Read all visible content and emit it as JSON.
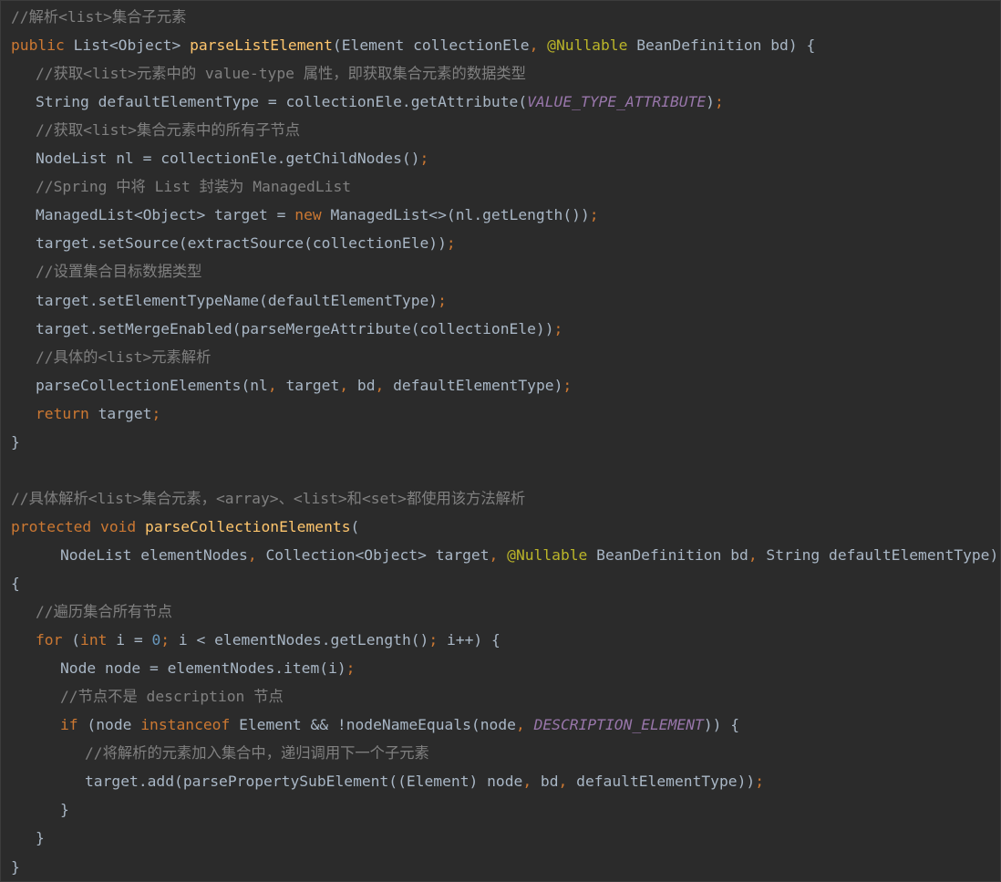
{
  "colors": {
    "background": "#2b2b2b",
    "plain": "#a9b7c6",
    "keyword": "#cc7832",
    "function": "#ffc66d",
    "comment": "#808080",
    "constant": "#9876aa",
    "annotation": "#bbb529",
    "number": "#6897bb"
  },
  "lines": [
    {
      "indent": 0,
      "tokens": [
        {
          "t": "//解析<list>集合子元素",
          "c": "cm"
        }
      ]
    },
    {
      "indent": 0,
      "tokens": [
        {
          "t": "public ",
          "c": "kw"
        },
        {
          "t": "List<Object> ",
          "c": "plain"
        },
        {
          "t": "parseListElement",
          "c": "fn"
        },
        {
          "t": "(Element collectionEle",
          "c": "plain"
        },
        {
          "t": ", ",
          "c": "kw"
        },
        {
          "t": "@Nullable ",
          "c": "ann"
        },
        {
          "t": "BeanDefinition bd) {",
          "c": "plain"
        }
      ]
    },
    {
      "indent": 1,
      "tokens": [
        {
          "t": "//获取<list>元素中的 value-type 属性，即获取集合元素的数据类型",
          "c": "cm"
        }
      ]
    },
    {
      "indent": 1,
      "tokens": [
        {
          "t": "String defaultElementType = collectionEle.getAttribute(",
          "c": "plain"
        },
        {
          "t": "VALUE_TYPE_ATTRIBUTE",
          "c": "const"
        },
        {
          "t": ")",
          "c": "plain"
        },
        {
          "t": ";",
          "c": "kw"
        }
      ]
    },
    {
      "indent": 1,
      "tokens": [
        {
          "t": "//获取<list>集合元素中的所有子节点",
          "c": "cm"
        }
      ]
    },
    {
      "indent": 1,
      "tokens": [
        {
          "t": "NodeList nl = collectionEle.getChildNodes()",
          "c": "plain"
        },
        {
          "t": ";",
          "c": "kw"
        }
      ]
    },
    {
      "indent": 1,
      "tokens": [
        {
          "t": "//Spring 中将 List 封装为 ManagedList",
          "c": "cm"
        }
      ]
    },
    {
      "indent": 1,
      "tokens": [
        {
          "t": "ManagedList<Object> target = ",
          "c": "plain"
        },
        {
          "t": "new ",
          "c": "kw"
        },
        {
          "t": "ManagedList<>(nl.getLength())",
          "c": "plain"
        },
        {
          "t": ";",
          "c": "kw"
        }
      ]
    },
    {
      "indent": 1,
      "tokens": [
        {
          "t": "target.setSource(extractSource(collectionEle))",
          "c": "plain"
        },
        {
          "t": ";",
          "c": "kw"
        }
      ]
    },
    {
      "indent": 1,
      "tokens": [
        {
          "t": "//设置集合目标数据类型",
          "c": "cm"
        }
      ]
    },
    {
      "indent": 1,
      "tokens": [
        {
          "t": "target.setElementTypeName(defaultElementType)",
          "c": "plain"
        },
        {
          "t": ";",
          "c": "kw"
        }
      ]
    },
    {
      "indent": 1,
      "tokens": [
        {
          "t": "target.setMergeEnabled(parseMergeAttribute(collectionEle))",
          "c": "plain"
        },
        {
          "t": ";",
          "c": "kw"
        }
      ]
    },
    {
      "indent": 1,
      "tokens": [
        {
          "t": "//具体的<list>元素解析",
          "c": "cm"
        }
      ]
    },
    {
      "indent": 1,
      "tokens": [
        {
          "t": "parseCollectionElements(nl",
          "c": "plain"
        },
        {
          "t": ", ",
          "c": "kw"
        },
        {
          "t": "target",
          "c": "plain"
        },
        {
          "t": ", ",
          "c": "kw"
        },
        {
          "t": "bd",
          "c": "plain"
        },
        {
          "t": ", ",
          "c": "kw"
        },
        {
          "t": "defaultElementType)",
          "c": "plain"
        },
        {
          "t": ";",
          "c": "kw"
        }
      ]
    },
    {
      "indent": 1,
      "tokens": [
        {
          "t": "return ",
          "c": "kw"
        },
        {
          "t": "target",
          "c": "plain"
        },
        {
          "t": ";",
          "c": "kw"
        }
      ]
    },
    {
      "indent": 0,
      "tokens": [
        {
          "t": "}",
          "c": "plain"
        }
      ]
    },
    {
      "indent": 0,
      "tokens": []
    },
    {
      "indent": 0,
      "tokens": [
        {
          "t": "//具体解析<list>集合元素，<array>、<list>和<set>都使用该方法解析",
          "c": "cm"
        }
      ]
    },
    {
      "indent": 0,
      "tokens": [
        {
          "t": "protected void ",
          "c": "kw"
        },
        {
          "t": "parseCollectionElements",
          "c": "fn"
        },
        {
          "t": "(",
          "c": "plain"
        }
      ]
    },
    {
      "indent": 2,
      "tokens": [
        {
          "t": "NodeList elementNodes",
          "c": "plain"
        },
        {
          "t": ", ",
          "c": "kw"
        },
        {
          "t": "Collection<Object> target",
          "c": "plain"
        },
        {
          "t": ", ",
          "c": "kw"
        },
        {
          "t": "@Nullable ",
          "c": "ann"
        },
        {
          "t": "BeanDefinition bd",
          "c": "plain"
        },
        {
          "t": ", ",
          "c": "kw"
        },
        {
          "t": "String defaultElementType)",
          "c": "plain"
        }
      ]
    },
    {
      "indent": 0,
      "tokens": [
        {
          "t": "{",
          "c": "plain"
        }
      ]
    },
    {
      "indent": 1,
      "tokens": [
        {
          "t": "//遍历集合所有节点",
          "c": "cm"
        }
      ]
    },
    {
      "indent": 1,
      "tokens": [
        {
          "t": "for ",
          "c": "kw"
        },
        {
          "t": "(",
          "c": "plain"
        },
        {
          "t": "int ",
          "c": "kw"
        },
        {
          "t": "i = ",
          "c": "plain"
        },
        {
          "t": "0",
          "c": "num"
        },
        {
          "t": "; ",
          "c": "kw"
        },
        {
          "t": "i < elementNodes.getLength()",
          "c": "plain"
        },
        {
          "t": "; ",
          "c": "kw"
        },
        {
          "t": "i++) {",
          "c": "plain"
        }
      ]
    },
    {
      "indent": 2,
      "tokens": [
        {
          "t": "Node node = elementNodes.item(i)",
          "c": "plain"
        },
        {
          "t": ";",
          "c": "kw"
        }
      ]
    },
    {
      "indent": 2,
      "tokens": [
        {
          "t": "//节点不是 description 节点",
          "c": "cm"
        }
      ]
    },
    {
      "indent": 2,
      "tokens": [
        {
          "t": "if ",
          "c": "kw"
        },
        {
          "t": "(node ",
          "c": "plain"
        },
        {
          "t": "instanceof ",
          "c": "kw"
        },
        {
          "t": "Element && !nodeNameEquals(node",
          "c": "plain"
        },
        {
          "t": ", ",
          "c": "kw"
        },
        {
          "t": "DESCRIPTION_ELEMENT",
          "c": "const"
        },
        {
          "t": ")) {",
          "c": "plain"
        }
      ]
    },
    {
      "indent": 3,
      "tokens": [
        {
          "t": "//将解析的元素加入集合中，递归调用下一个子元素",
          "c": "cm"
        }
      ]
    },
    {
      "indent": 3,
      "tokens": [
        {
          "t": "target.add(parsePropertySubElement((Element) node",
          "c": "plain"
        },
        {
          "t": ", ",
          "c": "kw"
        },
        {
          "t": "bd",
          "c": "plain"
        },
        {
          "t": ", ",
          "c": "kw"
        },
        {
          "t": "defaultElementType))",
          "c": "plain"
        },
        {
          "t": ";",
          "c": "kw"
        }
      ]
    },
    {
      "indent": 2,
      "tokens": [
        {
          "t": "}",
          "c": "plain"
        }
      ]
    },
    {
      "indent": 1,
      "tokens": [
        {
          "t": "}",
          "c": "plain"
        }
      ]
    },
    {
      "indent": 0,
      "tokens": [
        {
          "t": "}",
          "c": "plain"
        }
      ]
    }
  ]
}
